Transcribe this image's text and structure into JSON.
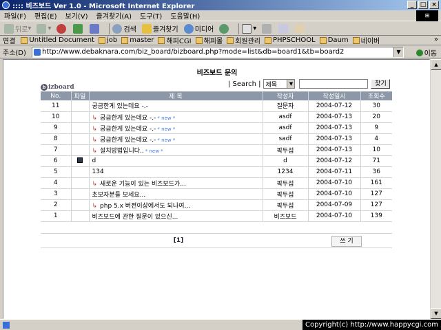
{
  "window": {
    "title": ":::: 비즈보드 Ver 1.0 - Microsoft Internet Explorer"
  },
  "menu": [
    "파일(F)",
    "편집(E)",
    "보기(V)",
    "즐겨찾기(A)",
    "도구(T)",
    "도움말(H)"
  ],
  "toolbar": {
    "back": "뒤로",
    "search": "검색",
    "favorites": "즐겨찾기",
    "media": "미디어"
  },
  "links": {
    "label": "연결",
    "items": [
      "Untitled Document",
      "job",
      "master",
      "해피CGI",
      "해피몰",
      "회원관리",
      "PHPSCHOOL",
      "Daum",
      "네이버"
    ]
  },
  "address": {
    "label": "주소(D)",
    "url": "http://www.debaknara.com/biz_board/bizboard.php?mode=list&db=board1&tb=board2",
    "go": "이동"
  },
  "board": {
    "title": "비즈보드 문의",
    "logo": "izboard",
    "search_label": "| Search |",
    "search_select": "제목",
    "search_button": "찾기",
    "columns": [
      "No.",
      "파일",
      "제 목",
      "작성자",
      "작성일시",
      "조회수"
    ],
    "rows": [
      {
        "no": "11",
        "file": false,
        "reply": false,
        "subject": "궁금한게 있는데요 -.-",
        "new": false,
        "author": "질문자",
        "date": "2004-07-12",
        "views": "30"
      },
      {
        "no": "10",
        "file": false,
        "reply": true,
        "subject": "궁금한게 있는데요 -.-",
        "new": true,
        "author": "asdf",
        "date": "2004-07-13",
        "views": "20"
      },
      {
        "no": "9",
        "file": false,
        "reply": true,
        "subject": "궁금한게 있는데요 -.-",
        "new": true,
        "author": "asdf",
        "date": "2004-07-13",
        "views": "9"
      },
      {
        "no": "8",
        "file": false,
        "reply": true,
        "subject": "궁금한게 있는데요 -.-",
        "new": true,
        "author": "sadf",
        "date": "2004-07-13",
        "views": "4"
      },
      {
        "no": "7",
        "file": false,
        "reply": true,
        "subject": "설치방법입니다..",
        "new": true,
        "author": "팍두섭",
        "date": "2004-07-13",
        "views": "10"
      },
      {
        "no": "6",
        "file": true,
        "reply": false,
        "subject": "d",
        "new": false,
        "author": "d",
        "date": "2004-07-12",
        "views": "71"
      },
      {
        "no": "5",
        "file": false,
        "reply": false,
        "subject": "134",
        "new": false,
        "author": "1234",
        "date": "2004-07-11",
        "views": "36"
      },
      {
        "no": "4",
        "file": false,
        "reply": true,
        "subject": "새로운 기능이 있는 비즈보드가...",
        "new": false,
        "author": "팍두섭",
        "date": "2004-07-10",
        "views": "161"
      },
      {
        "no": "3",
        "file": false,
        "reply": false,
        "subject": "초보자분들 보세요...",
        "new": false,
        "author": "팍두섭",
        "date": "2004-07-10",
        "views": "127"
      },
      {
        "no": "2",
        "file": false,
        "reply": true,
        "subject": "php 5.x 버젼이상에서도 되나여...",
        "new": false,
        "author": "팍두섭",
        "date": "2004-07-09",
        "views": "127"
      },
      {
        "no": "1",
        "file": false,
        "reply": false,
        "subject": "비즈보드에 관한 질문이 있으신...",
        "new": false,
        "author": "비즈보드",
        "date": "2004-07-10",
        "views": "139"
      }
    ],
    "new_label": "new",
    "pager": "[1]",
    "write_button": "쓰 기"
  },
  "status": {
    "copyright": "Copyright(c) http://www.happycgi.com"
  }
}
